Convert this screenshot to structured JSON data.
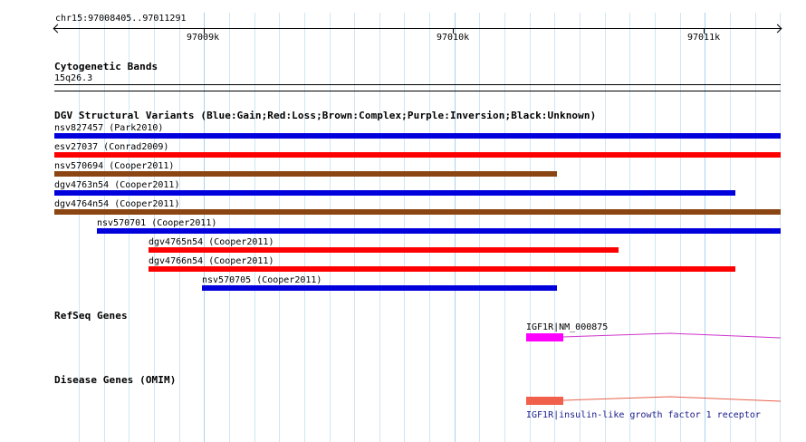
{
  "ruler": {
    "range_label": "chr15:97008405..97011291",
    "ticks": [
      "97009k",
      "97010k",
      "97011k"
    ]
  },
  "cytoband": {
    "title": "Cytogenetic Bands",
    "band": "15q26.3"
  },
  "dgv": {
    "title": "DGV Structural Variants (Blue:Gain;Red:Loss;Brown:Complex;Purple:Inversion;Black:Unknown)",
    "variants": [
      {
        "label": "nsv827457 (Park2010)",
        "type": "Gain",
        "color": "#0000dd"
      },
      {
        "label": "esv27037 (Conrad2009)",
        "type": "Loss",
        "color": "#ff0000"
      },
      {
        "label": "nsv570694 (Cooper2011)",
        "type": "Complex",
        "color": "#8b4513"
      },
      {
        "label": "dgv4763n54 (Cooper2011)",
        "type": "Gain",
        "color": "#0000dd"
      },
      {
        "label": "dgv4764n54 (Cooper2011)",
        "type": "Complex",
        "color": "#8b4513"
      },
      {
        "label": "nsv570701 (Cooper2011)",
        "type": "Gain",
        "color": "#0000dd"
      },
      {
        "label": "dgv4765n54 (Cooper2011)",
        "type": "Loss",
        "color": "#ff0000"
      },
      {
        "label": "dgv4766n54 (Cooper2011)",
        "type": "Loss",
        "color": "#ff0000"
      },
      {
        "label": "nsv570705 (Cooper2011)",
        "type": "Gain",
        "color": "#0000dd"
      }
    ]
  },
  "refseq": {
    "title": "RefSeq Genes",
    "gene_label": "IGF1R|NM_000875",
    "exon_color": "#ff00ff",
    "intron_color": "#cc33cc"
  },
  "omim": {
    "title": "Disease Genes (OMIM)",
    "gene_label": "IGF1R|insulin-like growth factor 1 receptor",
    "exon_color": "#f0604a",
    "intron_color": "#e8604a",
    "label_color": "#1a1a8c"
  }
}
